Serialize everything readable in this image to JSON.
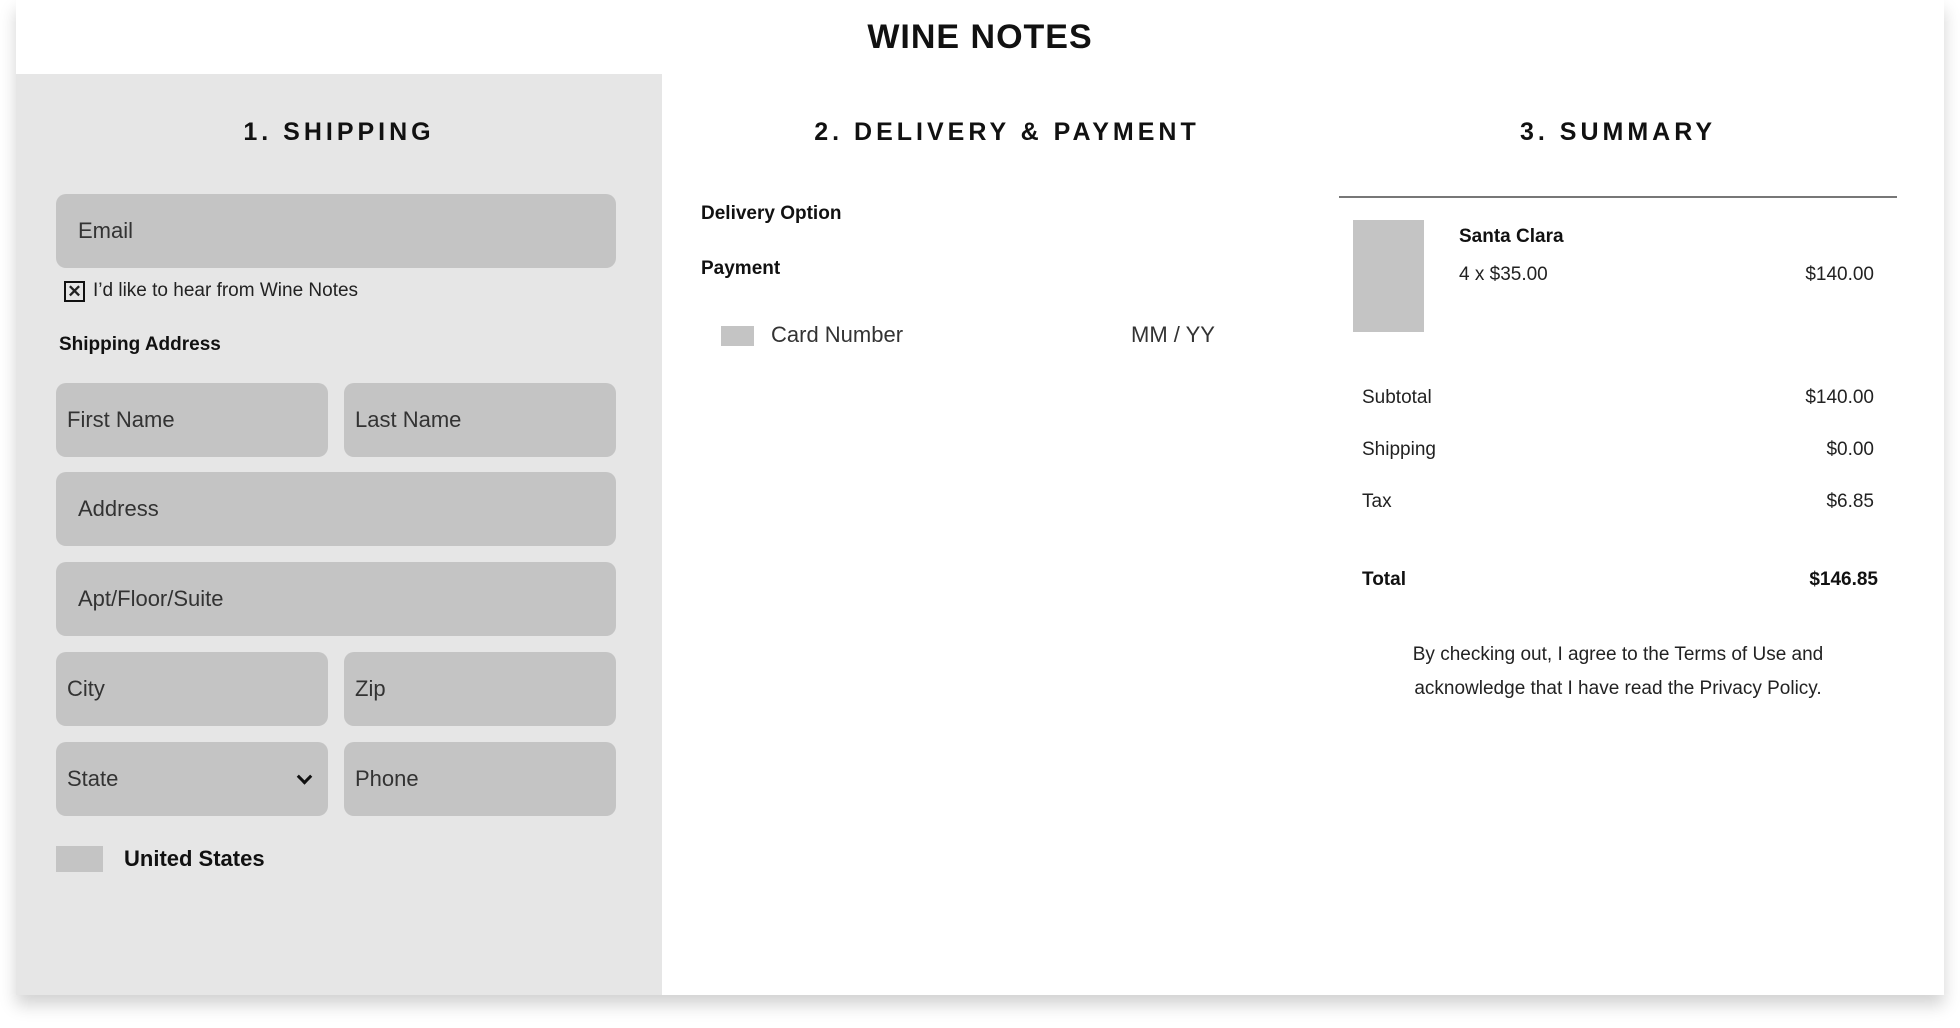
{
  "brand": {
    "title": "WINE NOTES"
  },
  "shipping": {
    "title": "1. SHIPPING",
    "email_placeholder": "Email",
    "optin_mark": "✕",
    "optin_label": "I’d like to hear from Wine Notes",
    "address_heading": "Shipping Address",
    "first_name_placeholder": "First Name",
    "last_name_placeholder": "Last Name",
    "address_placeholder": "Address",
    "apt_placeholder": "Apt/Floor/Suite",
    "city_placeholder": "City",
    "zip_placeholder": "Zip",
    "state_placeholder": "State",
    "phone_placeholder": "Phone",
    "country": "United States"
  },
  "delivery": {
    "title": "2. DELIVERY & PAYMENT",
    "delivery_option_label": "Delivery Option",
    "payment_label": "Payment",
    "card_number_placeholder": "Card Number",
    "expiry_placeholder": "MM / YY"
  },
  "summary": {
    "title": "3. SUMMARY",
    "item": {
      "name": "Santa Clara",
      "qty_price": "4 x $35.00",
      "line_total": "$140.00"
    },
    "subtotal_label": "Subtotal",
    "subtotal_value": "$140.00",
    "shipping_label": "Shipping",
    "shipping_value": "$0.00",
    "tax_label": "Tax",
    "tax_value": "$6.85",
    "total_label": "Total",
    "total_value": "$146.85",
    "legal_line1": "By checking out, I agree to the Terms of Use and",
    "legal_line2": "acknowledge that I have read the Privacy Policy."
  }
}
